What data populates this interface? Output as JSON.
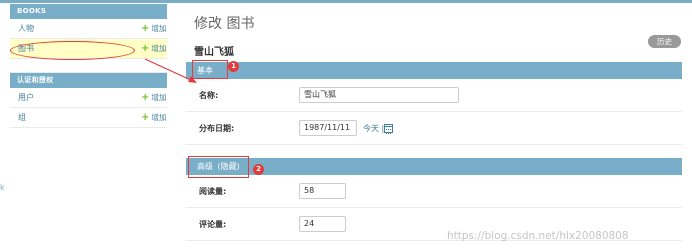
{
  "sidebar": {
    "modules": [
      {
        "caption": "BOOKS",
        "items": [
          {
            "name": "人物",
            "add_label": "增加"
          },
          {
            "name": "图书",
            "add_label": "增加"
          }
        ]
      },
      {
        "caption": "认证和授权",
        "items": [
          {
            "name": "用户",
            "add_label": "增加"
          },
          {
            "name": "组",
            "add_label": "增加"
          }
        ]
      }
    ],
    "edge_glyph": "k"
  },
  "main": {
    "page_title": "修改 图书",
    "object_title": "雪山飞狐",
    "history_label": "历史",
    "fieldsets": [
      {
        "caption": "基本",
        "fields": [
          {
            "label": "名称:",
            "value": "雪山飞狐"
          },
          {
            "label": "分布日期:",
            "value": "1987/11/11",
            "today_label": "今天",
            "separator": "|"
          }
        ]
      },
      {
        "caption": "高级",
        "collapse_label": "(隐藏)",
        "fields": [
          {
            "label": "阅读量:",
            "value": "58"
          },
          {
            "label": "评论量:",
            "value": "24"
          }
        ]
      }
    ]
  },
  "annotations": {
    "badge_1": "1",
    "badge_2": "2"
  },
  "watermark": "https://blog.csdn.net/hlx20080808",
  "colors": {
    "header_blue": "#79aec8",
    "link_blue": "#447e9b",
    "add_green": "#70bf2b",
    "selected_row": "#ffffc6",
    "annotation_red": "#e33b3b"
  }
}
